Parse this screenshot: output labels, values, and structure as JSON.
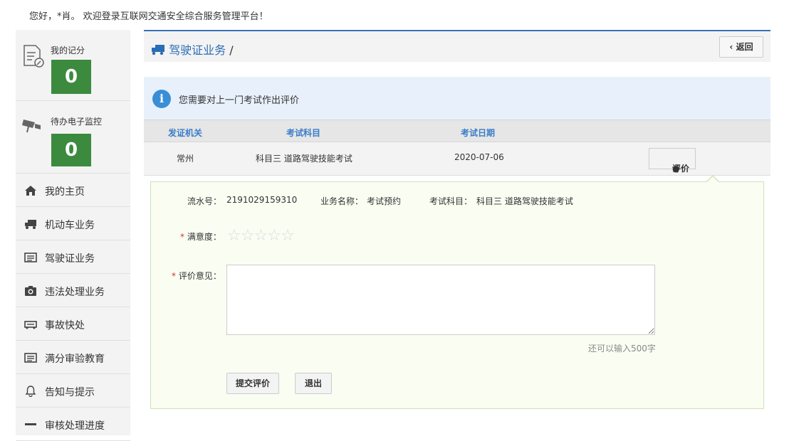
{
  "header": {
    "welcome": "您好，*肖。 欢迎登录互联网交通安全综合服务管理平台！"
  },
  "sidebar": {
    "score": {
      "label": "我的记分",
      "value": "0"
    },
    "monitor": {
      "label": "待办电子监控",
      "value": "0"
    },
    "items": [
      {
        "label": "我的主页",
        "icon": "home-icon"
      },
      {
        "label": "机动车业务",
        "icon": "truck-icon"
      },
      {
        "label": "驾驶证业务",
        "icon": "card-icon"
      },
      {
        "label": "违法处理业务",
        "icon": "camera-icon"
      },
      {
        "label": "事故快处",
        "icon": "car-icon"
      },
      {
        "label": "满分审验教育",
        "icon": "card-icon"
      },
      {
        "label": "告知与提示",
        "icon": "bell-icon"
      },
      {
        "label": "审核处理进度",
        "icon": "list-icon"
      }
    ]
  },
  "breadcrumb": {
    "title": "驾驶证业务",
    "sep": "/"
  },
  "back_label": "返回",
  "info": {
    "text": "您需要对上一门考试作出评价"
  },
  "table": {
    "headers": [
      "发证机关",
      "考试科目",
      "考试日期"
    ],
    "row": {
      "authority": "常州",
      "subject": "科目三 道路驾驶技能考试",
      "date": "2020-07-06",
      "action": "评价"
    }
  },
  "form": {
    "serial_label": "流水号：",
    "serial": "2191029159310",
    "biz_label": "业务名称：",
    "biz": "考试预约",
    "subject_label": "考试科目：",
    "subject": "科目三 道路驾驶技能考试",
    "satisfaction_label": "满意度：",
    "opinion_label": "评价意见：",
    "counter": "还可以输入500字",
    "submit": "提交评价",
    "exit": "退出"
  },
  "colors": {
    "accent": "#2a6db5",
    "badge": "#3b8a3e"
  }
}
